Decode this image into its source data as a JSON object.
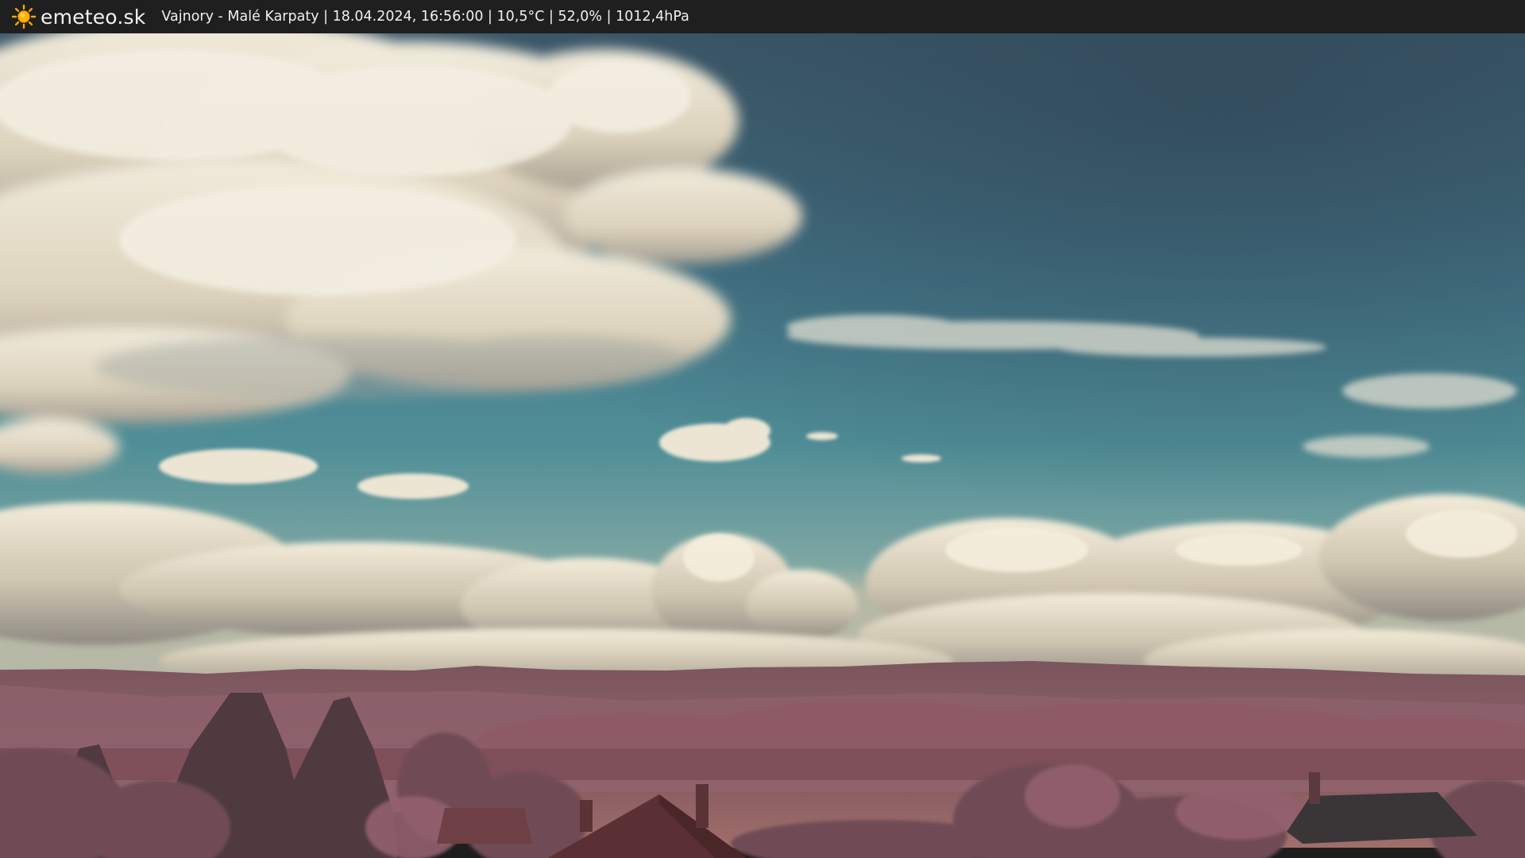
{
  "header": {
    "brand": "emeteo.sk",
    "caption": "Vajnory - Malé Karpaty | 18.04.2024, 16:56:00 | 10,5°C | 52,0% | 1012,4hPa",
    "logo_icon": "sun-icon"
  },
  "colors": {
    "bar": "#1f1f1f",
    "sun": "#f5a300",
    "sky_top": "#3e5868",
    "sky_mid": "#4a8a95",
    "cloud": "#e9e2cf",
    "hills": "#8a5a66",
    "foliage": "#7a4c58"
  }
}
